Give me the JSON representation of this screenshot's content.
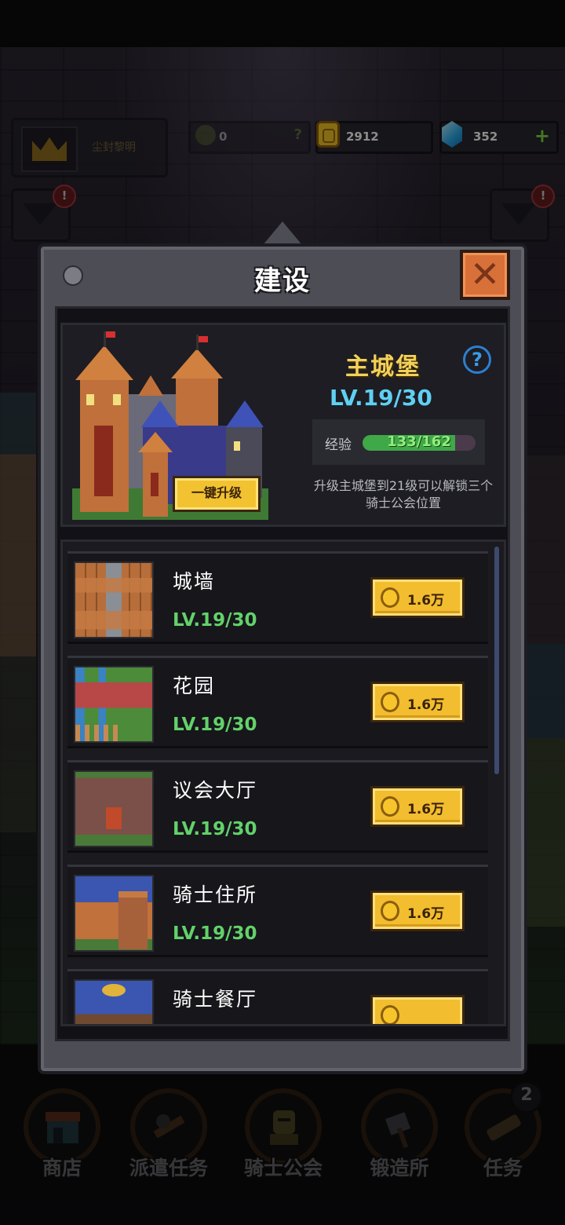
{
  "hud": {
    "profile_name": "尘封黎明",
    "knight_points": "0",
    "knight_help": "?",
    "gold": "2912",
    "gems": "352",
    "gems_add": "+",
    "side_alert": "!"
  },
  "modal": {
    "title": "建设",
    "close": "✕"
  },
  "castle": {
    "name": "主城堡",
    "level": "LV.19/30",
    "help": "?",
    "exp_label": "经验",
    "exp_text": "133/162",
    "exp_current": 133,
    "exp_max": 162,
    "upgrade_all_label": "一键升级",
    "description": "升级主城堡到21级可以解锁三个骑士公会位置"
  },
  "buildings": [
    {
      "name": "城墙",
      "level": "LV.19/30",
      "cost": "1.6万",
      "icon": "wall-icon"
    },
    {
      "name": "花园",
      "level": "LV.19/30",
      "cost": "1.6万",
      "icon": "garden-icon"
    },
    {
      "name": "议会大厅",
      "level": "LV.19/30",
      "cost": "1.6万",
      "icon": "council-hall-icon"
    },
    {
      "name": "骑士住所",
      "level": "LV.19/30",
      "cost": "1.6万",
      "icon": "knight-quarters-icon"
    },
    {
      "name": "骑士餐厅",
      "level": "",
      "cost": "",
      "icon": "knight-dining-icon"
    }
  ],
  "nav": {
    "items": [
      {
        "label": "商店",
        "icon": "shop-icon"
      },
      {
        "label": "派遣任务",
        "icon": "dispatch-icon"
      },
      {
        "label": "骑士公会",
        "icon": "knight-guild-icon"
      },
      {
        "label": "锻造所",
        "icon": "forge-icon"
      },
      {
        "label": "任务",
        "icon": "quest-icon",
        "badge": "2"
      }
    ]
  },
  "colors": {
    "gold_accent": "#f2c230",
    "level_green": "#63d16a",
    "castle_level_blue": "#5fd0f2",
    "castle_name_yellow": "#f3d15a",
    "close_orange": "#d8703a"
  }
}
